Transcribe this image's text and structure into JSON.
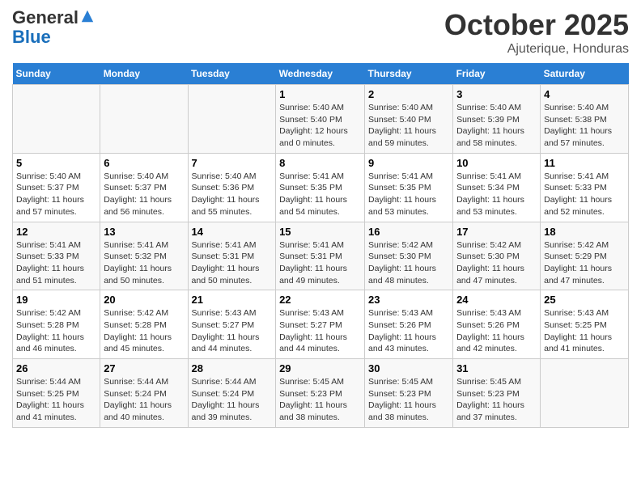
{
  "header": {
    "logo_general": "General",
    "logo_blue": "Blue",
    "month": "October 2025",
    "location": "Ajuterique, Honduras"
  },
  "days_of_week": [
    "Sunday",
    "Monday",
    "Tuesday",
    "Wednesday",
    "Thursday",
    "Friday",
    "Saturday"
  ],
  "weeks": [
    [
      {
        "day": "",
        "info": ""
      },
      {
        "day": "",
        "info": ""
      },
      {
        "day": "",
        "info": ""
      },
      {
        "day": "1",
        "info": "Sunrise: 5:40 AM\nSunset: 5:40 PM\nDaylight: 12 hours\nand 0 minutes."
      },
      {
        "day": "2",
        "info": "Sunrise: 5:40 AM\nSunset: 5:40 PM\nDaylight: 11 hours\nand 59 minutes."
      },
      {
        "day": "3",
        "info": "Sunrise: 5:40 AM\nSunset: 5:39 PM\nDaylight: 11 hours\nand 58 minutes."
      },
      {
        "day": "4",
        "info": "Sunrise: 5:40 AM\nSunset: 5:38 PM\nDaylight: 11 hours\nand 57 minutes."
      }
    ],
    [
      {
        "day": "5",
        "info": "Sunrise: 5:40 AM\nSunset: 5:37 PM\nDaylight: 11 hours\nand 57 minutes."
      },
      {
        "day": "6",
        "info": "Sunrise: 5:40 AM\nSunset: 5:37 PM\nDaylight: 11 hours\nand 56 minutes."
      },
      {
        "day": "7",
        "info": "Sunrise: 5:40 AM\nSunset: 5:36 PM\nDaylight: 11 hours\nand 55 minutes."
      },
      {
        "day": "8",
        "info": "Sunrise: 5:41 AM\nSunset: 5:35 PM\nDaylight: 11 hours\nand 54 minutes."
      },
      {
        "day": "9",
        "info": "Sunrise: 5:41 AM\nSunset: 5:35 PM\nDaylight: 11 hours\nand 53 minutes."
      },
      {
        "day": "10",
        "info": "Sunrise: 5:41 AM\nSunset: 5:34 PM\nDaylight: 11 hours\nand 53 minutes."
      },
      {
        "day": "11",
        "info": "Sunrise: 5:41 AM\nSunset: 5:33 PM\nDaylight: 11 hours\nand 52 minutes."
      }
    ],
    [
      {
        "day": "12",
        "info": "Sunrise: 5:41 AM\nSunset: 5:33 PM\nDaylight: 11 hours\nand 51 minutes."
      },
      {
        "day": "13",
        "info": "Sunrise: 5:41 AM\nSunset: 5:32 PM\nDaylight: 11 hours\nand 50 minutes."
      },
      {
        "day": "14",
        "info": "Sunrise: 5:41 AM\nSunset: 5:31 PM\nDaylight: 11 hours\nand 50 minutes."
      },
      {
        "day": "15",
        "info": "Sunrise: 5:41 AM\nSunset: 5:31 PM\nDaylight: 11 hours\nand 49 minutes."
      },
      {
        "day": "16",
        "info": "Sunrise: 5:42 AM\nSunset: 5:30 PM\nDaylight: 11 hours\nand 48 minutes."
      },
      {
        "day": "17",
        "info": "Sunrise: 5:42 AM\nSunset: 5:30 PM\nDaylight: 11 hours\nand 47 minutes."
      },
      {
        "day": "18",
        "info": "Sunrise: 5:42 AM\nSunset: 5:29 PM\nDaylight: 11 hours\nand 47 minutes."
      }
    ],
    [
      {
        "day": "19",
        "info": "Sunrise: 5:42 AM\nSunset: 5:28 PM\nDaylight: 11 hours\nand 46 minutes."
      },
      {
        "day": "20",
        "info": "Sunrise: 5:42 AM\nSunset: 5:28 PM\nDaylight: 11 hours\nand 45 minutes."
      },
      {
        "day": "21",
        "info": "Sunrise: 5:43 AM\nSunset: 5:27 PM\nDaylight: 11 hours\nand 44 minutes."
      },
      {
        "day": "22",
        "info": "Sunrise: 5:43 AM\nSunset: 5:27 PM\nDaylight: 11 hours\nand 44 minutes."
      },
      {
        "day": "23",
        "info": "Sunrise: 5:43 AM\nSunset: 5:26 PM\nDaylight: 11 hours\nand 43 minutes."
      },
      {
        "day": "24",
        "info": "Sunrise: 5:43 AM\nSunset: 5:26 PM\nDaylight: 11 hours\nand 42 minutes."
      },
      {
        "day": "25",
        "info": "Sunrise: 5:43 AM\nSunset: 5:25 PM\nDaylight: 11 hours\nand 41 minutes."
      }
    ],
    [
      {
        "day": "26",
        "info": "Sunrise: 5:44 AM\nSunset: 5:25 PM\nDaylight: 11 hours\nand 41 minutes."
      },
      {
        "day": "27",
        "info": "Sunrise: 5:44 AM\nSunset: 5:24 PM\nDaylight: 11 hours\nand 40 minutes."
      },
      {
        "day": "28",
        "info": "Sunrise: 5:44 AM\nSunset: 5:24 PM\nDaylight: 11 hours\nand 39 minutes."
      },
      {
        "day": "29",
        "info": "Sunrise: 5:45 AM\nSunset: 5:23 PM\nDaylight: 11 hours\nand 38 minutes."
      },
      {
        "day": "30",
        "info": "Sunrise: 5:45 AM\nSunset: 5:23 PM\nDaylight: 11 hours\nand 38 minutes."
      },
      {
        "day": "31",
        "info": "Sunrise: 5:45 AM\nSunset: 5:23 PM\nDaylight: 11 hours\nand 37 minutes."
      },
      {
        "day": "",
        "info": ""
      }
    ]
  ]
}
